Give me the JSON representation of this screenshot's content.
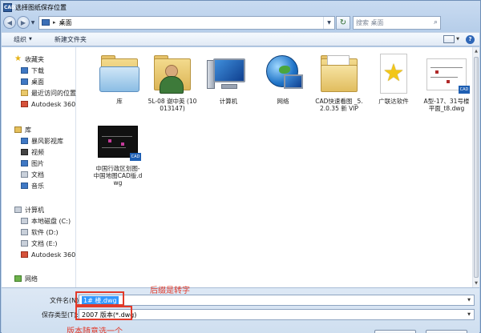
{
  "window": {
    "title": "选择图纸保存位置",
    "app_icon": "CAD"
  },
  "address": {
    "location": "桌面",
    "crumb_sep": "▸",
    "search_placeholder": "搜索 桌面"
  },
  "toolbar": {
    "organize": "组织",
    "new_folder": "新建文件夹",
    "help": "?"
  },
  "nav": {
    "favorites": {
      "label": "收藏夹",
      "items": [
        "下载",
        "桌面",
        "最近访问的位置",
        "Autodesk 360"
      ]
    },
    "libraries": {
      "label": "库",
      "items": [
        "暴风影视库",
        "视频",
        "图片",
        "文档",
        "音乐"
      ]
    },
    "computer": {
      "label": "计算机",
      "items": [
        "本地磁盘 (C:)",
        "软件 (D:)",
        "文档 (E:)",
        "Autodesk 360"
      ]
    },
    "network": {
      "label": "网络"
    }
  },
  "files": [
    {
      "label": "库"
    },
    {
      "label": "5L-08 谢中英 (10013147)"
    },
    {
      "label": "计算机"
    },
    {
      "label": "网络"
    },
    {
      "label": "CAD快速看图 _5.2.0.35 新 VIP"
    },
    {
      "label": "广联达软件"
    },
    {
      "label": "A型-17、31号楼 平面_t8.dwg",
      "badge": "CAD"
    },
    {
      "label": "中国行政区划图-中国地图CAD版.dwg",
      "badge": "CAD"
    }
  ],
  "save": {
    "filename_label": "文件名(N):",
    "filename_value": "1#  楼.dwg",
    "type_label": "保存类型(T):",
    "type_value": "2007 版本(*.dwg)"
  },
  "annotations": {
    "suffix_note": "后缀是转字",
    "version_note": "版本随意选一个"
  },
  "colors": {
    "annotation": "#e23a2a",
    "selection": "#3297fd"
  }
}
